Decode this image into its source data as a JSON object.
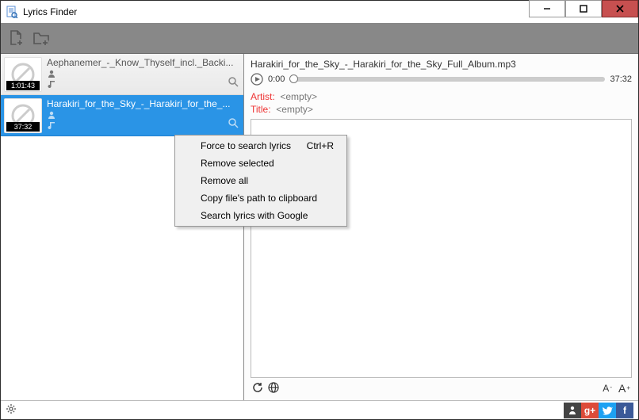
{
  "title": "Lyrics Finder",
  "tracks": [
    {
      "name": "Aephanemer_-_Know_Thyself_incl._Backi...",
      "duration": "1:01:43",
      "selected": false
    },
    {
      "name": "Harakiri_for_the_Sky_-_Harakiri_for_the_...",
      "duration": "37:32",
      "selected": true
    }
  ],
  "nowPlaying": {
    "file": "Harakiri_for_the_Sky_-_Harakiri_for_the_Sky_Full_Album.mp3",
    "pos": "0:00",
    "dur": "37:32",
    "artistLabel": "Artist:",
    "artistValue": "<empty>",
    "titleLabel": "Title:",
    "titleValue": "<empty>"
  },
  "fontSmaller": "A",
  "fontLarger": "A",
  "contextMenu": {
    "items": [
      {
        "label": "Force to search lyrics",
        "shortcut": "Ctrl+R"
      },
      {
        "label": "Remove selected",
        "shortcut": ""
      },
      {
        "label": "Remove all",
        "shortcut": ""
      },
      {
        "label": "Copy file's path to clipboard",
        "shortcut": ""
      },
      {
        "label": "Search lyrics with Google",
        "shortcut": ""
      }
    ]
  },
  "social": {
    "gp": "g+",
    "tw": "y",
    "fb": "f"
  }
}
